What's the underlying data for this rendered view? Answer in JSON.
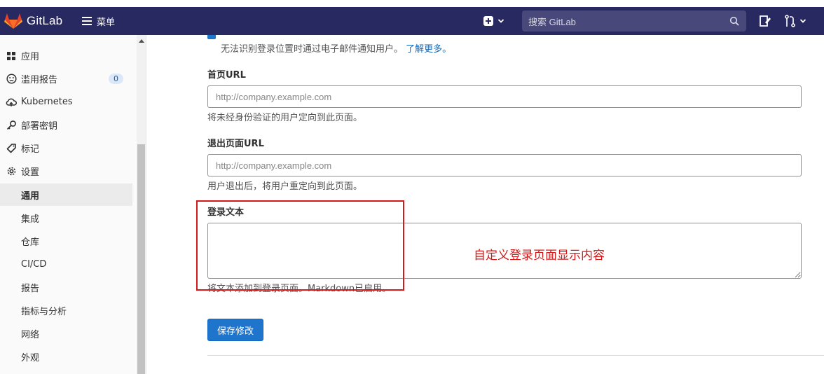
{
  "navbar": {
    "brand": "GitLab",
    "menu_label": "菜单",
    "search_placeholder": "搜索 GitLab"
  },
  "sidebar": {
    "items": [
      {
        "label": "应用",
        "icon": "grid-icon"
      },
      {
        "label": "滥用报告",
        "icon": "face-icon",
        "count": "0"
      },
      {
        "label": "Kubernetes",
        "icon": "cloud-icon"
      },
      {
        "label": "部署密钥",
        "icon": "key-icon"
      },
      {
        "label": "标记",
        "icon": "tag-icon"
      },
      {
        "label": "设置",
        "icon": "gear-icon"
      }
    ],
    "subitems": [
      {
        "label": "通用",
        "active": true
      },
      {
        "label": "集成"
      },
      {
        "label": "仓库"
      },
      {
        "label": "CI/CD"
      },
      {
        "label": "报告"
      },
      {
        "label": "指标与分析"
      },
      {
        "label": "网络"
      },
      {
        "label": "外观"
      }
    ]
  },
  "main": {
    "notify_help": "无法识别登录位置时通过电子邮件通知用户。",
    "notify_link": "了解更多。",
    "home_url": {
      "label": "首页URL",
      "placeholder": "http://company.example.com",
      "help": "将未经身份验证的用户定向到此页面。"
    },
    "signout_url": {
      "label": "退出页面URL",
      "placeholder": "http://company.example.com",
      "help": "用户退出后，将用户重定向到此页面。"
    },
    "signin_text": {
      "label": "登录文本",
      "value": "",
      "help": "将文本添加到登录页面。Markdown已启用。"
    },
    "annotation": "自定义登录页面显示内容",
    "save_label": "保存修改"
  },
  "colors": {
    "navbar": "#292961",
    "accent": "#1f75cb",
    "annotation": "#d41919"
  }
}
